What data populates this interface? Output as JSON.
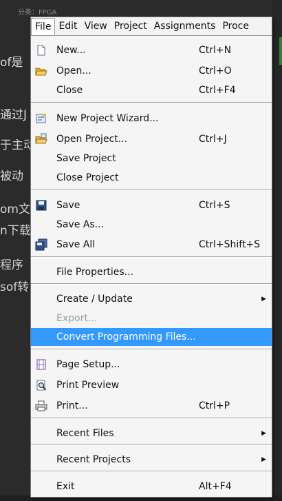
{
  "background": {
    "crumb": "分类：FPGA",
    "lines": [
      "of是",
      "通过J",
      "于主动",
      "被动",
      "om文",
      "n下载",
      "程序",
      "sof转"
    ]
  },
  "menubar": {
    "items": [
      "File",
      "Edit",
      "View",
      "Project",
      "Assignments",
      "Proce"
    ]
  },
  "file_menu": {
    "new": {
      "label": "New...",
      "shortcut": "Ctrl+N"
    },
    "open": {
      "label": "Open...",
      "shortcut": "Ctrl+O"
    },
    "close": {
      "label": "Close",
      "shortcut": "Ctrl+F4"
    },
    "new_project_wizard": {
      "label": "New Project Wizard..."
    },
    "open_project": {
      "label": "Open Project...",
      "shortcut": "Ctrl+J"
    },
    "save_project": {
      "label": "Save Project"
    },
    "close_project": {
      "label": "Close Project"
    },
    "save": {
      "label": "Save",
      "shortcut": "Ctrl+S"
    },
    "save_as": {
      "label": "Save As..."
    },
    "save_all": {
      "label": "Save All",
      "shortcut": "Ctrl+Shift+S"
    },
    "file_properties": {
      "label": "File Properties..."
    },
    "create_update": {
      "label": "Create / Update"
    },
    "export": {
      "label": "Export..."
    },
    "convert_programming_files": {
      "label": "Convert Programming Files..."
    },
    "page_setup": {
      "label": "Page Setup..."
    },
    "print_preview": {
      "label": "Print Preview"
    },
    "print": {
      "label": "Print...",
      "shortcut": "Ctrl+P"
    },
    "recent_files": {
      "label": "Recent Files"
    },
    "recent_projects": {
      "label": "Recent Projects"
    },
    "exit": {
      "label": "Exit",
      "shortcut": "Alt+F4"
    }
  },
  "colors": {
    "selection": "#3399ff"
  }
}
